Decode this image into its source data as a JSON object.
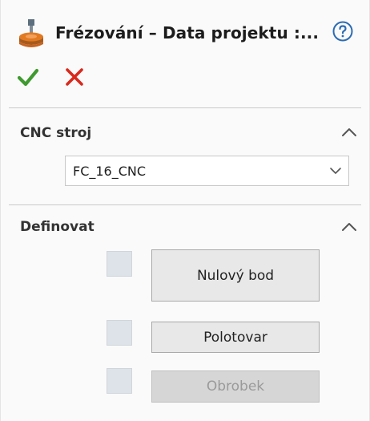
{
  "header": {
    "title": "Frézování – Data projektu :...",
    "app_icon": "milling-tool-icon",
    "help_icon": "help-circle-icon",
    "ok_icon": "checkmark-icon",
    "cancel_icon": "close-icon",
    "colors": {
      "ok": "#3f9a2f",
      "cancel": "#d9291c",
      "help": "#2b6cb3"
    }
  },
  "sections": {
    "cnc": {
      "title": "CNC stroj",
      "collapse_icon": "chevron-up-icon",
      "machine_select": {
        "value": "FC_16_CNC",
        "chevron_icon": "chevron-down-icon"
      }
    },
    "define": {
      "title": "Definovat",
      "collapse_icon": "chevron-up-icon",
      "items": [
        {
          "label": "Nulový bod",
          "enabled": true
        },
        {
          "label": "Polotovar",
          "enabled": true
        },
        {
          "label": "Obrobek",
          "enabled": false
        }
      ]
    }
  }
}
